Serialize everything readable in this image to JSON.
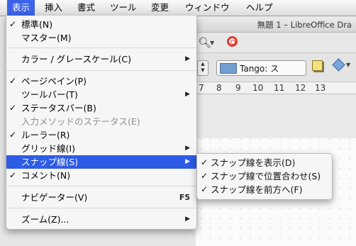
{
  "menubar": {
    "items": [
      "表示",
      "挿入",
      "書式",
      "ツール",
      "変更",
      "ウィンドウ",
      "ヘルプ"
    ],
    "active_index": 0
  },
  "window": {
    "title": "無題 1 – LibreOffice Dra"
  },
  "toolbar": {
    "color_name": "Tango: ス",
    "color_swatch": "#729fcf",
    "icons": [
      "zoom-icon",
      "help-lifebuoy-icon",
      "shadow-icon",
      "line-style-icon"
    ]
  },
  "ruler": {
    "ticks": [
      "7",
      "8",
      "9",
      "10",
      "11",
      "12",
      "13"
    ]
  },
  "view_menu": {
    "items": [
      {
        "label": "標準(N)",
        "checked": true
      },
      {
        "label": "マスター(M)",
        "checked": false
      },
      {
        "label": "カラー / グレースケール(C)",
        "checked": false,
        "submenu": true
      },
      {
        "label": "ページペイン(P)",
        "checked": true
      },
      {
        "label": "ツールバー(T)",
        "checked": false,
        "submenu": true
      },
      {
        "label": "ステータスバー(B)",
        "checked": true
      },
      {
        "label": "入力メソッドのステータス(E)",
        "checked": false,
        "disabled": true
      },
      {
        "label": "ルーラー(R)",
        "checked": true
      },
      {
        "label": "グリッド線(I)",
        "checked": false,
        "submenu": true
      },
      {
        "label": "スナップ線(S)",
        "checked": false,
        "submenu": true,
        "highlighted": true
      },
      {
        "label": "コメント(N)",
        "checked": true
      },
      {
        "label": "ナビゲーター(V)",
        "checked": false,
        "shortcut": "F5"
      },
      {
        "label": "ズーム(Z)...",
        "checked": false,
        "submenu": true
      }
    ],
    "check_glyph": "✓",
    "arrow_glyph": "▶"
  },
  "snap_submenu": {
    "items": [
      {
        "label": "スナップ線を表示(D)",
        "checked": true
      },
      {
        "label": "スナップ線で位置合わせ(S)",
        "checked": true
      },
      {
        "label": "スナップ線を前方へ(F)",
        "checked": true
      }
    ]
  },
  "colors": {
    "highlight": "#2d5ce6",
    "menubar_active": "#3b62e8"
  }
}
